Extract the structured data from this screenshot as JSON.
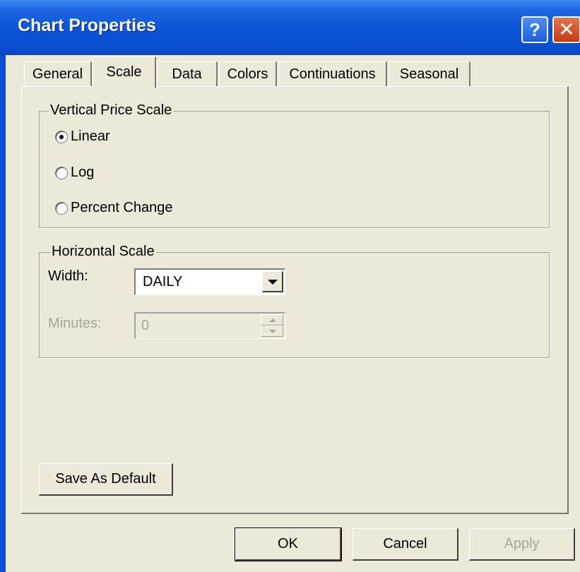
{
  "window": {
    "title": "Chart Properties",
    "help_glyph": "?",
    "close_glyph": "✕"
  },
  "tabs": [
    {
      "label": "General"
    },
    {
      "label": "Scale"
    },
    {
      "label": "Data"
    },
    {
      "label": "Colors"
    },
    {
      "label": "Continuations"
    },
    {
      "label": "Seasonal"
    }
  ],
  "active_tab": "Scale",
  "vertical_scale": {
    "legend": "Vertical Price Scale",
    "options": [
      "Linear",
      "Log",
      "Percent Change"
    ],
    "selected": "Linear"
  },
  "horizontal_scale": {
    "legend": "Horizontal Scale",
    "width_label": "Width:",
    "width_value": "DAILY",
    "minutes_label": "Minutes:",
    "minutes_value": "0"
  },
  "buttons": {
    "save_default": "Save As Default",
    "ok": "OK",
    "cancel": "Cancel",
    "apply": "Apply"
  }
}
